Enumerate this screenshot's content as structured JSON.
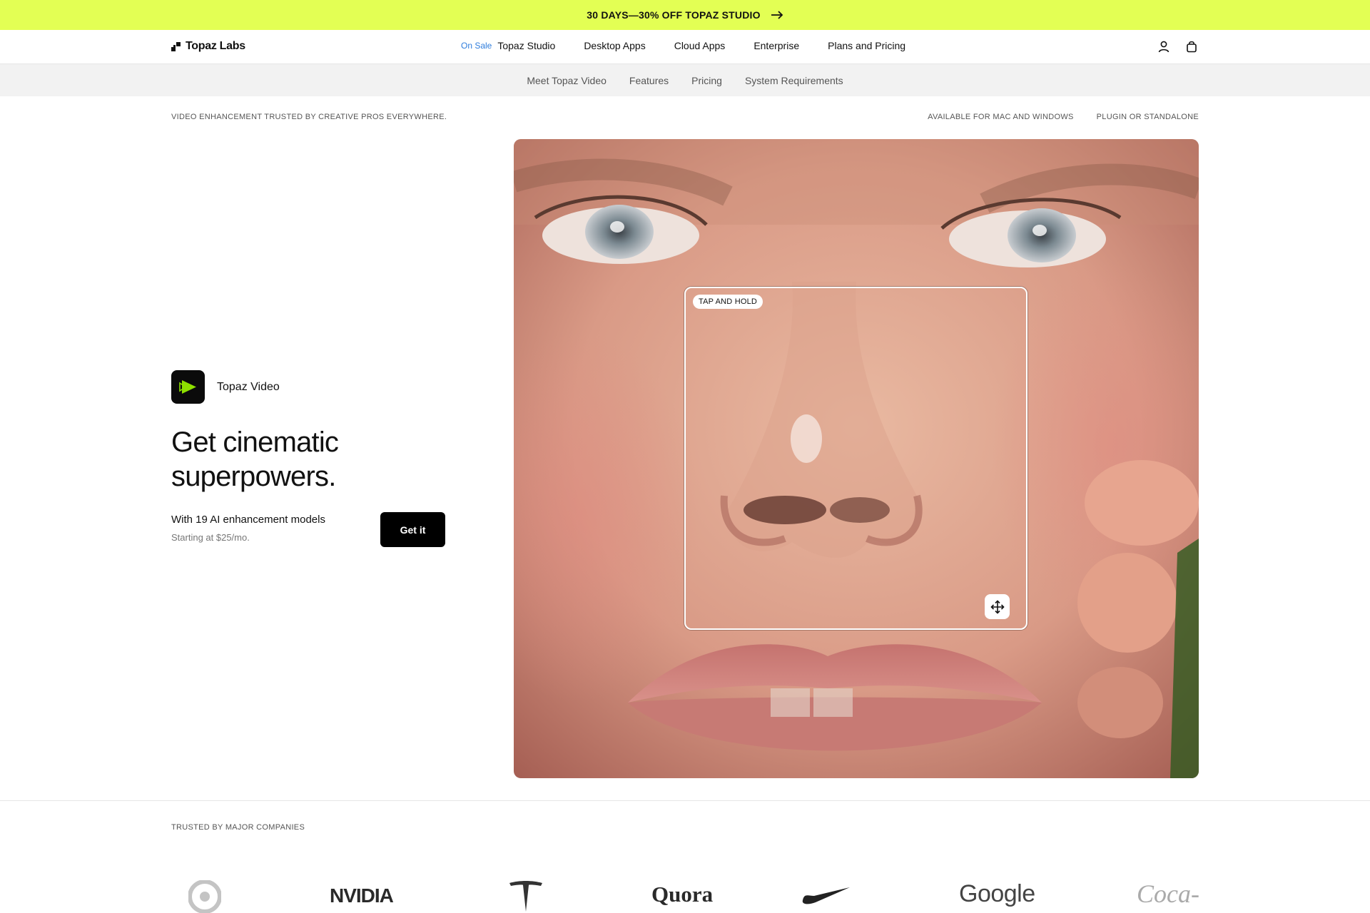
{
  "promo": {
    "text": "30 DAYS—30% OFF TOPAZ STUDIO",
    "background": "#e3ff54"
  },
  "nav": {
    "logo": "Topaz Labs",
    "onsale_badge": "On Sale",
    "links": [
      "Topaz Studio",
      "Desktop Apps",
      "Cloud Apps",
      "Enterprise",
      "Plans and Pricing"
    ],
    "icons": [
      "account-icon",
      "cart-icon"
    ]
  },
  "subnav": {
    "links": [
      "Meet Topaz Video",
      "Features",
      "Pricing",
      "System Requirements"
    ]
  },
  "info": {
    "left": "VIDEO ENHANCEMENT TRUSTED BY CREATIVE PROS EVERYWHERE.",
    "right": [
      "AVAILABLE FOR MAC AND WINDOWS",
      "PLUGIN OR STANDALONE"
    ]
  },
  "hero": {
    "product_name": "Topaz Video",
    "headline": "Get cinematic superpowers.",
    "subline": "With 19 AI enhancement models",
    "price_note": "Starting at $25/mo.",
    "cta_label": "Get it",
    "accent": "#8ee000",
    "compare_label": "TAP AND HOLD",
    "move_icon": "move-icon"
  },
  "trusted": {
    "label": "TRUSTED BY MAJOR COMPANIES",
    "brands": [
      "target",
      "NVIDIA",
      "tesla",
      "Quora",
      "nike",
      "Google",
      "Coca-Cola"
    ]
  }
}
